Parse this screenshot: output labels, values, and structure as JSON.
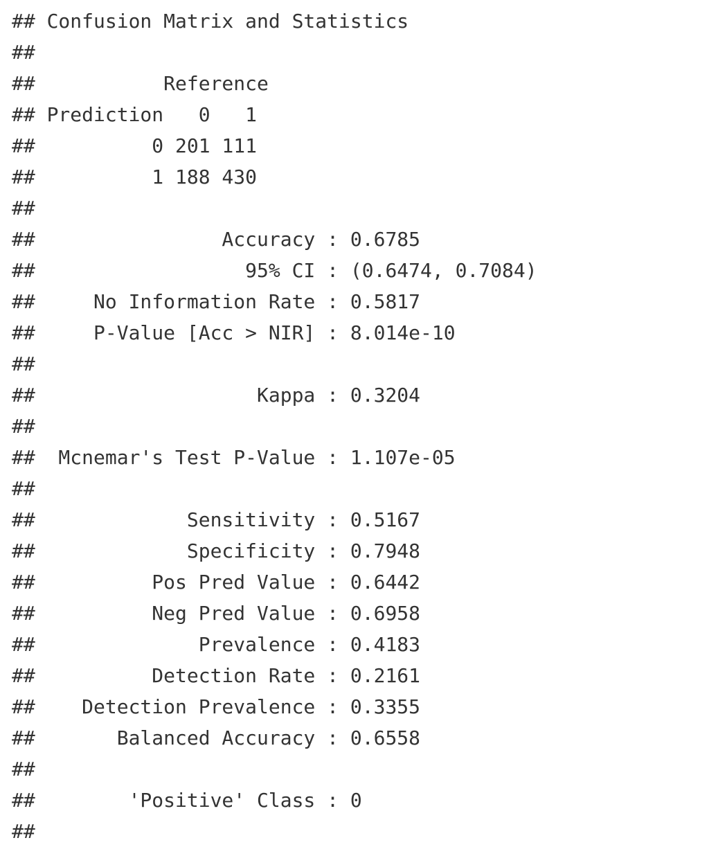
{
  "output": {
    "lines": [
      "## Confusion Matrix and Statistics",
      "##",
      "##           Reference",
      "## Prediction   0   1",
      "##          0 201 111",
      "##          1 188 430",
      "##",
      "##                Accuracy : 0.6785",
      "##                  95% CI : (0.6474, 0.7084)",
      "##     No Information Rate : 0.5817",
      "##     P-Value [Acc > NIR] : 8.014e-10",
      "##",
      "##                   Kappa : 0.3204",
      "##",
      "##  Mcnemar's Test P-Value : 1.107e-05",
      "##",
      "##             Sensitivity : 0.5167",
      "##             Specificity : 0.7948",
      "##          Pos Pred Value : 0.6442",
      "##          Neg Pred Value : 0.6958",
      "##              Prevalence : 0.4183",
      "##          Detection Rate : 0.2161",
      "##    Detection Prevalence : 0.3355",
      "##       Balanced Accuracy : 0.6558",
      "##",
      "##        'Positive' Class : 0",
      "##"
    ]
  }
}
